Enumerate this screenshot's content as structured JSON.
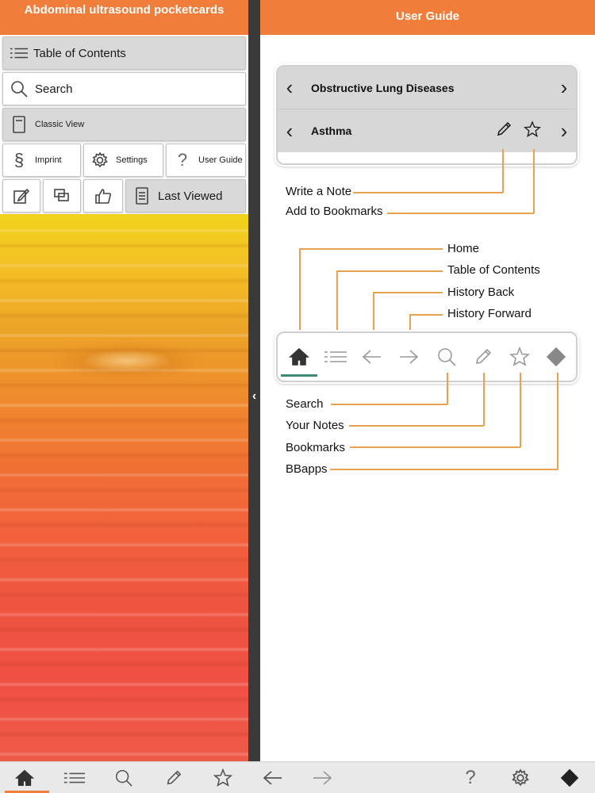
{
  "left_panel": {
    "title": "Abdominal ultrasound pocketcards",
    "menu": {
      "table_of_contents": "Table of Contents",
      "search": "Search",
      "classic_view": "Classic View",
      "imprint": "Imprint",
      "settings": "Settings",
      "user_guide": "User Guide",
      "last_viewed": "Last Viewed"
    }
  },
  "divider": {
    "collapse_glyph": "‹"
  },
  "right_panel": {
    "title": "User Guide",
    "sample_nav": {
      "chapter": "Obstructive Lung Diseases",
      "topic": "Asthma"
    },
    "callouts_top": {
      "write_note": "Write a Note",
      "add_bookmark": "Add to Bookmarks"
    },
    "callouts_toolbar_above": {
      "home": "Home",
      "toc": "Table of Contents",
      "history_back": "History Back",
      "history_forward": "History Forward"
    },
    "callouts_toolbar_below": {
      "search": "Search",
      "notes": "Your Notes",
      "bookmarks": "Bookmarks",
      "bbapps": "BBapps"
    }
  },
  "bottom_bar": {
    "icons": [
      "home-icon",
      "list-icon",
      "search-icon",
      "pencil-icon",
      "star-icon",
      "arrow-left-icon",
      "arrow-right-icon",
      "help-icon",
      "gear-icon",
      "bbapps-icon"
    ]
  },
  "colors": {
    "header": "#f07e3a",
    "divider": "#3a3a3a",
    "callout_line": "#e8a24d",
    "active_underline": "#3f8a77"
  }
}
